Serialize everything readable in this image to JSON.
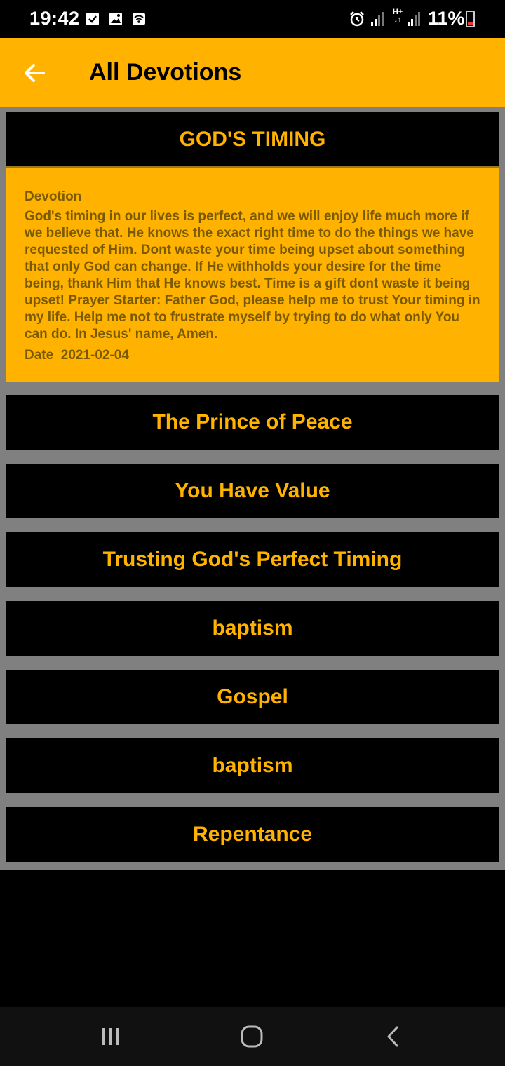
{
  "status": {
    "time": "19:42",
    "battery": "11%",
    "icons": [
      "checkbox-icon",
      "image-icon",
      "wifi-icon",
      "alarm-icon",
      "signal-icon",
      "hplus-icon",
      "signal-icon",
      "battery-icon"
    ],
    "network_label": "H+"
  },
  "app_bar": {
    "title": "All Devotions"
  },
  "expanded": {
    "title": "GOD'S TIMING",
    "label": "Devotion",
    "text": "God's timing in our lives is perfect, and we will enjoy life much more if we believe that. He knows the exact right time to do the things we have requested of Him. Dont waste your time being upset about something that only God can change. If He withholds your desire for the time being, thank Him that He knows best. Time is a gift dont waste it being upset! Prayer Starter: Father God, please help me to trust Your timing in my life. Help me not to frustrate myself by trying to do what only You can do. In Jesus' name, Amen.",
    "date_label": "Date",
    "date": "2021-02-04"
  },
  "devotions": [
    {
      "title": "The Prince of Peace"
    },
    {
      "title": "You Have Value"
    },
    {
      "title": "Trusting God's Perfect Timing"
    },
    {
      "title": "baptism"
    },
    {
      "title": "Gospel"
    },
    {
      "title": "baptism"
    },
    {
      "title": "Repentance"
    }
  ],
  "colors": {
    "accent": "#ffb300",
    "card": "#000000",
    "separator": "#808080"
  }
}
